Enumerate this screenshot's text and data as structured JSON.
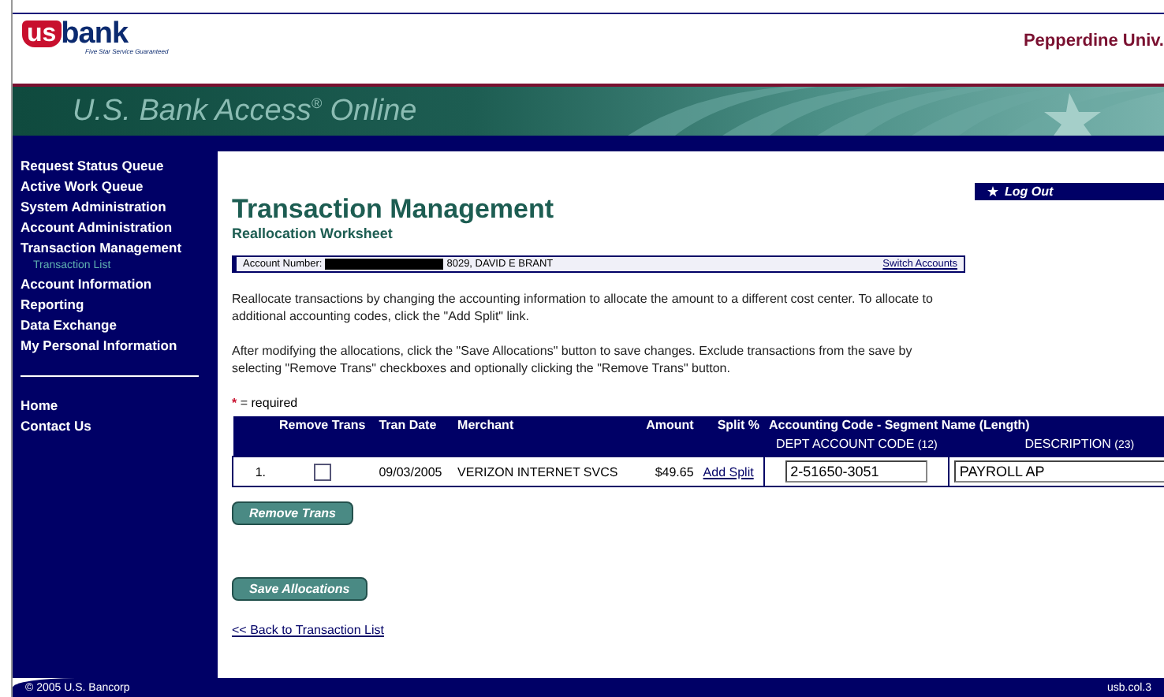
{
  "header": {
    "logo": {
      "us": "us",
      "bank": "bank",
      "tagline": "Five Star Service Guaranteed"
    },
    "organization": "Pepperdine Univ."
  },
  "banner": {
    "title": "U.S. Bank Access$^{®}$ Online"
  },
  "sidebar": {
    "items": [
      {
        "label": "Request Status Queue"
      },
      {
        "label": "Active Work Queue"
      },
      {
        "label": "System Administration"
      },
      {
        "label": "Account Administration"
      },
      {
        "label": "Transaction Management",
        "children": [
          {
            "label": "Transaction List"
          }
        ]
      },
      {
        "label": "Account Information"
      },
      {
        "label": "Reporting"
      },
      {
        "label": "Data Exchange"
      },
      {
        "label": "My Personal Information"
      }
    ],
    "links": [
      {
        "label": "Home"
      },
      {
        "label": "Contact Us"
      }
    ]
  },
  "logout": "Log Out",
  "page": {
    "title": "Transaction Management",
    "subtitle": "Reallocation Worksheet"
  },
  "account": {
    "label": "Account Number:",
    "value": "8029, DAVID E BRANT",
    "switch_link": "Switch Accounts"
  },
  "instructions": [
    "Reallocate transactions by changing the accounting information to allocate the amount to a different cost center. To allocate to additional accounting codes, click the \"Add Split\" link.",
    "After modifying the allocations, click the \"Save Allocations\" button to save changes. Exclude transactions from the save by selecting \"Remove Trans\" checkboxes and optionally clicking the \"Remove Trans\" button."
  ],
  "required_note": {
    "mark": "*",
    "text": "= required"
  },
  "table": {
    "columns": [
      "Remove Trans",
      "Tran Date",
      "Merchant",
      "Amount",
      "Split %",
      "Accounting Code - Segment Name (Length)"
    ],
    "segments": [
      {
        "name": "DEPT ACCOUNT CODE",
        "length": "(12)"
      },
      {
        "name": "DESCRIPTION",
        "length": "(23)"
      }
    ],
    "rows": [
      {
        "index": "1.",
        "checked": false,
        "tran_date": "09/03/2005",
        "merchant": "VERIZON INTERNET SVCS",
        "amount": "$49.65",
        "split_link": "Add Split",
        "segment_values": [
          "2-51650-3051",
          "PAYROLL AP"
        ]
      }
    ]
  },
  "buttons": [
    "Remove Trans",
    "Save Allocations"
  ],
  "back_link": "<< Back to Transaction List",
  "footer": {
    "copyright": "© 2005 U.S. Bancorp",
    "code": "usb.col.3"
  }
}
